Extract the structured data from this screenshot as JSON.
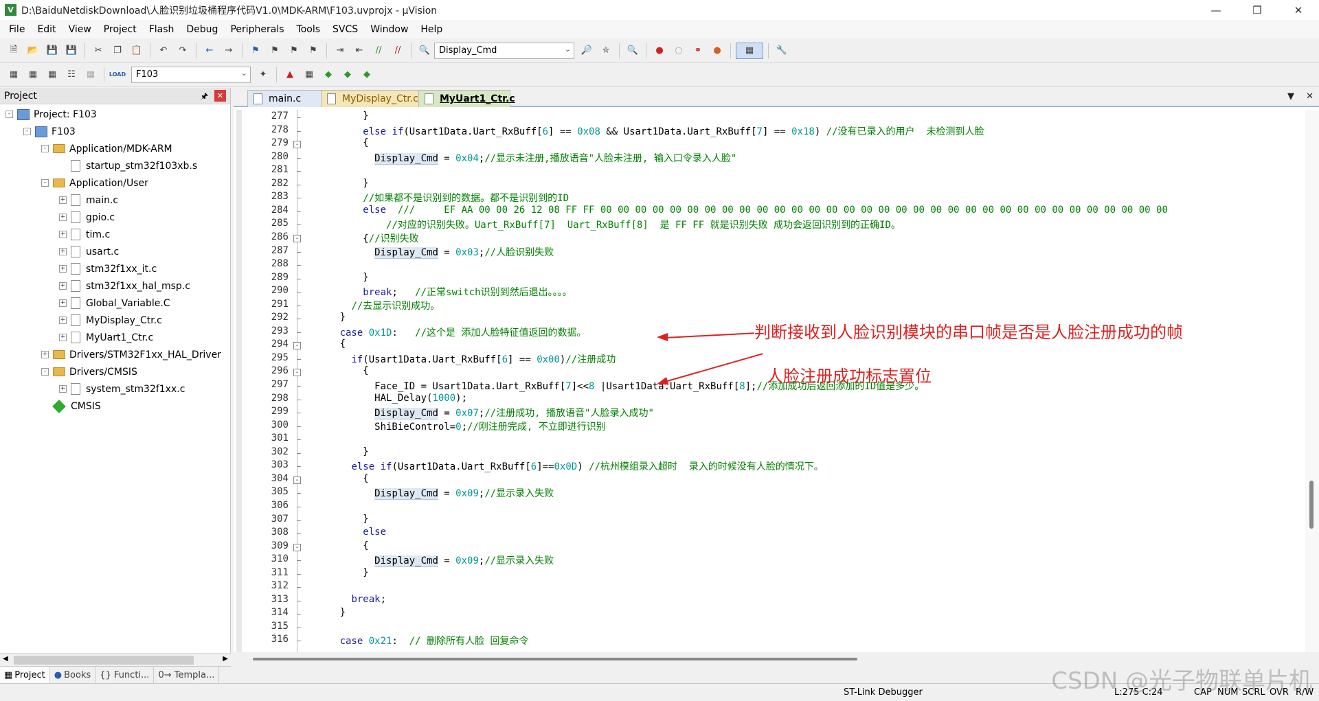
{
  "window": {
    "title": "D:\\BaiduNetdiskDownload\\人脸识别垃圾桶程序代码V1.0\\MDK-ARM\\F103.uvprojx - µVision",
    "app_icon_letter": "V",
    "min_icon": "minimize-icon",
    "max_icon": "restore-icon",
    "close_icon": "close-icon"
  },
  "menu": [
    "File",
    "Edit",
    "View",
    "Project",
    "Flash",
    "Debug",
    "Peripherals",
    "Tools",
    "SVCS",
    "Window",
    "Help"
  ],
  "toolbar": {
    "find_combo_value": "Display_Cmd",
    "target_combo_value": "F103",
    "target_load_label": "LOAD"
  },
  "project_panel": {
    "title": "Project",
    "pin_icon": "pin-icon",
    "close_icon": "close-icon",
    "tree": [
      {
        "label": "Project: F103",
        "level": 0,
        "kind": "root",
        "toggle": "-"
      },
      {
        "label": "F103",
        "level": 1,
        "kind": "target",
        "toggle": "-"
      },
      {
        "label": "Application/MDK-ARM",
        "level": 2,
        "kind": "folder",
        "toggle": "-"
      },
      {
        "label": "startup_stm32f103xb.s",
        "level": 3,
        "kind": "file",
        "toggle": ""
      },
      {
        "label": "Application/User",
        "level": 2,
        "kind": "folder",
        "toggle": "-"
      },
      {
        "label": "main.c",
        "level": 3,
        "kind": "file",
        "toggle": "+"
      },
      {
        "label": "gpio.c",
        "level": 3,
        "kind": "file",
        "toggle": "+"
      },
      {
        "label": "tim.c",
        "level": 3,
        "kind": "file",
        "toggle": "+"
      },
      {
        "label": "usart.c",
        "level": 3,
        "kind": "file",
        "toggle": "+"
      },
      {
        "label": "stm32f1xx_it.c",
        "level": 3,
        "kind": "file",
        "toggle": "+"
      },
      {
        "label": "stm32f1xx_hal_msp.c",
        "level": 3,
        "kind": "file",
        "toggle": "+"
      },
      {
        "label": "Global_Variable.C",
        "level": 3,
        "kind": "file",
        "toggle": "+"
      },
      {
        "label": "MyDisplay_Ctr.c",
        "level": 3,
        "kind": "file",
        "toggle": "+"
      },
      {
        "label": "MyUart1_Ctr.c",
        "level": 3,
        "kind": "file",
        "toggle": "+"
      },
      {
        "label": "Drivers/STM32F1xx_HAL_Driver",
        "level": 2,
        "kind": "folder",
        "toggle": "+"
      },
      {
        "label": "Drivers/CMSIS",
        "level": 2,
        "kind": "folder",
        "toggle": "-"
      },
      {
        "label": "system_stm32f1xx.c",
        "level": 3,
        "kind": "file",
        "toggle": "+"
      },
      {
        "label": "CMSIS",
        "level": 2,
        "kind": "gem",
        "toggle": ""
      }
    ],
    "bottom_tabs": [
      "Project",
      "Books",
      "{} Functi...",
      "0→ Templa..."
    ]
  },
  "editor": {
    "tabs": [
      "main.c",
      "MyDisplay_Ctr.c*",
      "MyUart1_Ctr.c"
    ],
    "active_tab": "MyUart1_Ctr.c",
    "tab_menu_icon": "chevron-down-icon",
    "tab_close_icon": "close-icon",
    "lines": [
      {
        "n": "277",
        "fold": "",
        "code": "          }"
      },
      {
        "n": "278",
        "fold": "",
        "code": "          else if(Usart1Data.Uart_RxBuff[6] == 0x08 && Usart1Data.Uart_RxBuff[7] == 0x18) //没有已录入的用户  未检测到人脸"
      },
      {
        "n": "279",
        "fold": "-",
        "code": "          {"
      },
      {
        "n": "280",
        "fold": "",
        "code": "            Display_Cmd = 0x04;//显示未注册,播放语音\"人脸未注册, 输入口令录入人脸\""
      },
      {
        "n": "281",
        "fold": "",
        "code": ""
      },
      {
        "n": "282",
        "fold": "",
        "code": "          }"
      },
      {
        "n": "283",
        "fold": "",
        "code": "          //如果都不是识别到的数据。都不是识别到的ID"
      },
      {
        "n": "284",
        "fold": "",
        "code": "          else  ///     EF AA 00 00 26 12 08 FF FF 00 00 00 00 00 00 00 00 00 00 00 00 00 00 00 00 00 00 00 00 00 00 00 00 00 00 00 00 00 00 00 00 00"
      },
      {
        "n": "285",
        "fold": "",
        "code": "              //对应的识别失败。Uart_RxBuff[7]  Uart_RxBuff[8]  是 FF FF 就是识别失败 成功会返回识别到的正确ID。"
      },
      {
        "n": "286",
        "fold": "-",
        "code": "          {//识别失败"
      },
      {
        "n": "287",
        "fold": "",
        "code": "            Display_Cmd = 0x03;//人脸识别失败"
      },
      {
        "n": "288",
        "fold": "",
        "code": ""
      },
      {
        "n": "289",
        "fold": "",
        "code": "          }"
      },
      {
        "n": "290",
        "fold": "",
        "code": "          break;   //正常switch识别到然后退出。。。。"
      },
      {
        "n": "291",
        "fold": "",
        "code": "        //去显示识别成功。"
      },
      {
        "n": "292",
        "fold": "",
        "code": "      }"
      },
      {
        "n": "293",
        "fold": "",
        "code": "      case 0x1D:   //这个是 添加人脸特征值返回的数据。"
      },
      {
        "n": "294",
        "fold": "-",
        "code": "      {"
      },
      {
        "n": "295",
        "fold": "",
        "code": "        if(Usart1Data.Uart_RxBuff[6] == 0x00)//注册成功"
      },
      {
        "n": "296",
        "fold": "-",
        "code": "          {"
      },
      {
        "n": "297",
        "fold": "",
        "code": "            Face_ID = Usart1Data.Uart_RxBuff[7]<<8 |Usart1Data.Uart_RxBuff[8];//添加成功后返回添加的ID值是多少。"
      },
      {
        "n": "298",
        "fold": "",
        "code": "            HAL_Delay(1000);"
      },
      {
        "n": "299",
        "fold": "",
        "code": "            Display_Cmd = 0x07;//注册成功, 播放语音\"人脸录入成功\""
      },
      {
        "n": "300",
        "fold": "",
        "code": "            ShiBieControl=0;//刚注册完成, 不立即进行识别"
      },
      {
        "n": "301",
        "fold": "",
        "code": ""
      },
      {
        "n": "302",
        "fold": "",
        "code": "          }"
      },
      {
        "n": "303",
        "fold": "",
        "code": "        else if(Usart1Data.Uart_RxBuff[6]==0x0D) //杭州模组录入超时  录入的时候没有人脸的情况下。"
      },
      {
        "n": "304",
        "fold": "-",
        "code": "          {"
      },
      {
        "n": "305",
        "fold": "",
        "code": "            Display_Cmd = 0x09;//显示录入失败"
      },
      {
        "n": "306",
        "fold": "",
        "code": ""
      },
      {
        "n": "307",
        "fold": "",
        "code": "          }"
      },
      {
        "n": "308",
        "fold": "",
        "code": "          else"
      },
      {
        "n": "309",
        "fold": "-",
        "code": "          {"
      },
      {
        "n": "310",
        "fold": "",
        "code": "            Display_Cmd = 0x09;//显示录入失败"
      },
      {
        "n": "311",
        "fold": "",
        "code": "          }"
      },
      {
        "n": "312",
        "fold": "",
        "code": ""
      },
      {
        "n": "313",
        "fold": "",
        "code": "        break;"
      },
      {
        "n": "314",
        "fold": "",
        "code": "      }"
      },
      {
        "n": "315",
        "fold": "",
        "code": ""
      },
      {
        "n": "316",
        "fold": "",
        "code": "      case 0x21:  // 删除所有人脸 回复命令"
      }
    ]
  },
  "annotations": [
    "判断接收到人脸识别模块的串口帧是否是人脸注册成功的帧",
    "人脸注册成功标志置位"
  ],
  "status": {
    "debugger": "ST-Link Debugger",
    "position": "L:275 C:24",
    "indicators": [
      "CAP",
      "NUM",
      "SCRL",
      "OVR",
      "R/W"
    ]
  },
  "watermark": "CSDN @光子物联单片机",
  "colors": {
    "keyword": "#1a1aa6",
    "number": "#009696",
    "comment": "#008000",
    "annotation": "#e02020"
  }
}
